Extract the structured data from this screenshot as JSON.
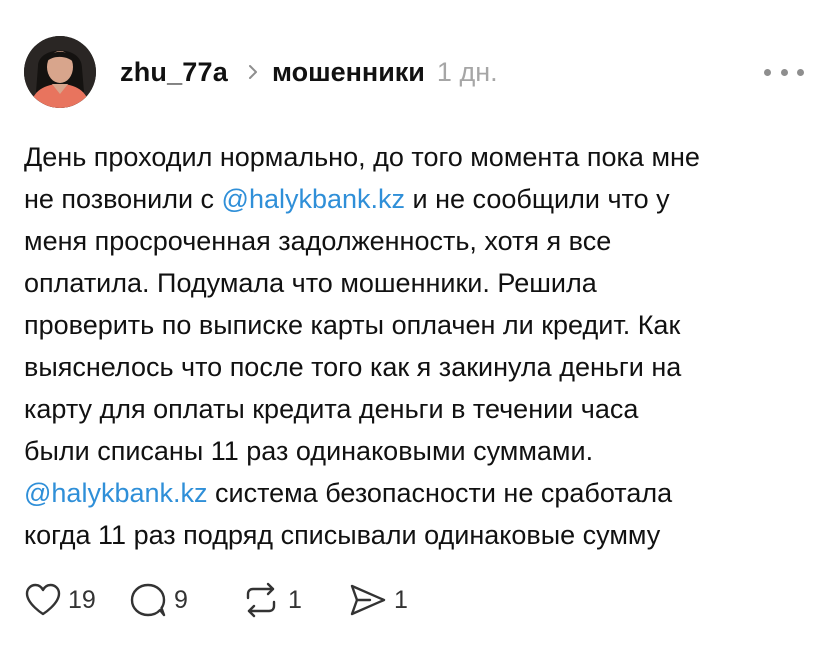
{
  "post": {
    "username": "zhu_77a",
    "topic": "мошенники",
    "time": "1 дн.",
    "body_lines": [
      [
        {
          "text": "День проходил нормально, до того момента пока мне"
        }
      ],
      [
        {
          "text": "не позвонили с "
        },
        {
          "text": "@halykbank.kz",
          "mention": true
        },
        {
          "text": " и не сообщили что у"
        }
      ],
      [
        {
          "text": "меня просроченная задолженность, хотя я все"
        }
      ],
      [
        {
          "text": "оплатила. Подумала что мошенники. Решила"
        }
      ],
      [
        {
          "text": "проверить по выписке карты оплачен ли кредит. Как"
        }
      ],
      [
        {
          "text": "выяснелось что после того как я закинула деньги на"
        }
      ],
      [
        {
          "text": "карту для оплаты кредита деньги в течении часа"
        }
      ],
      [
        {
          "text": "были списаны 11 раз одинаковыми суммами."
        }
      ],
      [
        {
          "text": "@halykbank.kz",
          "mention": true
        },
        {
          "text": " система безопасности не сработала"
        }
      ],
      [
        {
          "text": "когда 11 раз подряд списывали одинаковые сумму"
        }
      ]
    ]
  },
  "actions": {
    "likes": "19",
    "replies": "9",
    "reposts": "1",
    "shares": "1"
  },
  "icons": {
    "more": "more-horizontal-icon",
    "chevron": "chevron-right-icon",
    "like": "heart-icon",
    "reply": "speech-bubble-icon",
    "repost": "repost-arrows-icon",
    "share": "send-icon"
  },
  "colors": {
    "mention": "#2f8fd8",
    "time": "#a6a6a6",
    "text": "#111111",
    "icon": "#333333"
  }
}
